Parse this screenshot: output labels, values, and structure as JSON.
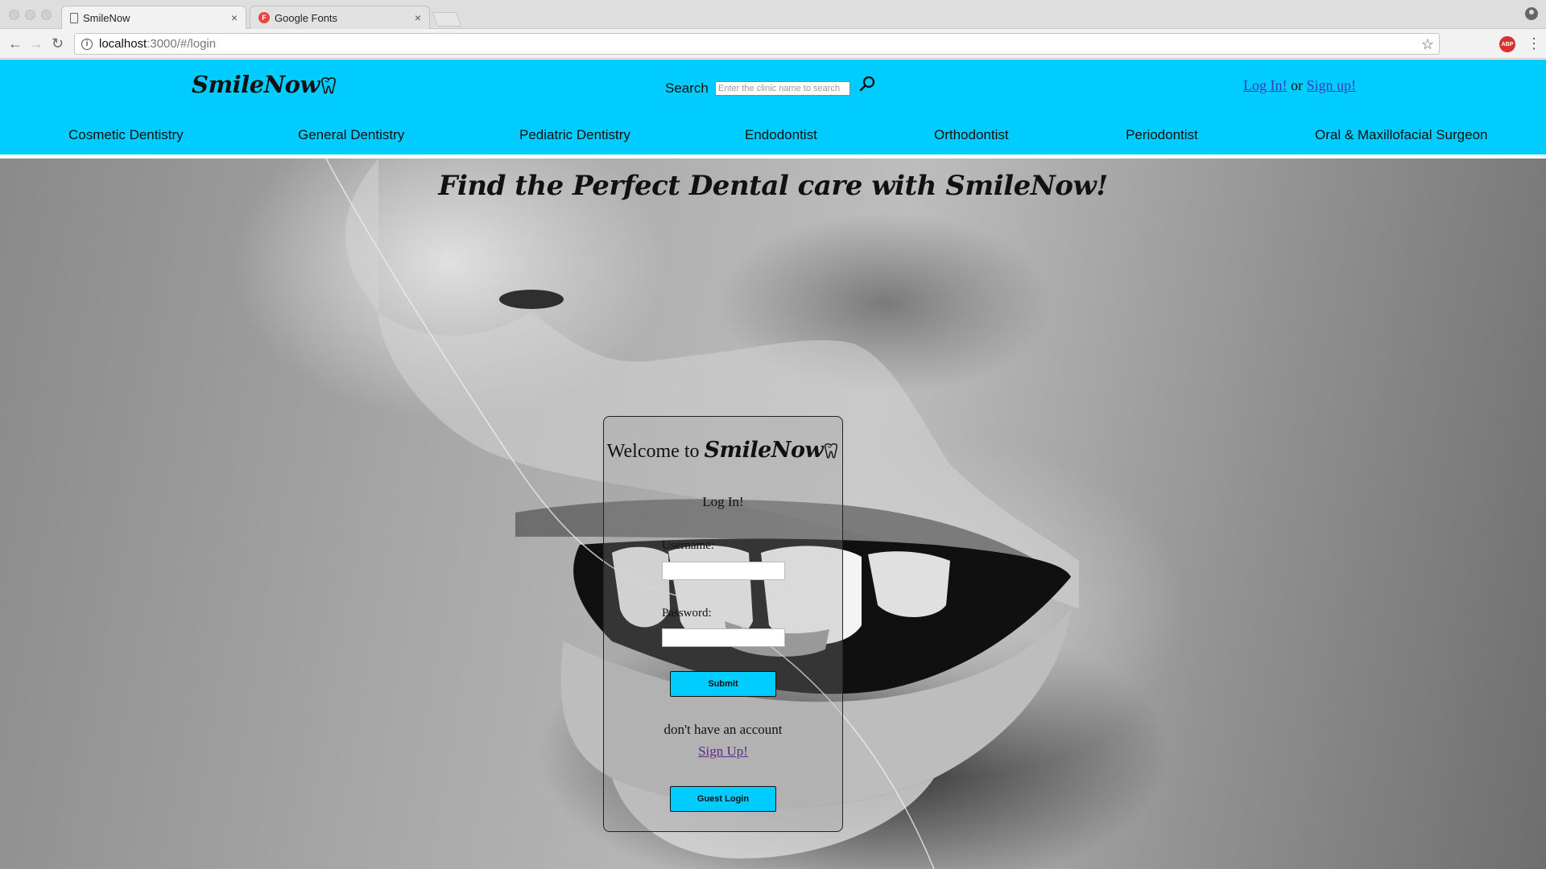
{
  "browser": {
    "tabs": [
      {
        "title": "SmileNow",
        "close": "×"
      },
      {
        "title": "Google Fonts",
        "close": "×",
        "favicon": "F"
      }
    ],
    "url_host": "localhost",
    "url_rest": ":3000/#/login",
    "abp_label": "ABP"
  },
  "header": {
    "logo": "SmileNow",
    "search_label": "Search",
    "search_placeholder": "Enter the clinic name to search",
    "auth": {
      "login": "Log In!",
      "or": "or",
      "signup": "Sign up!"
    },
    "categories": [
      "Cosmetic Dentistry",
      "General Dentistry",
      "Pediatric Dentistry",
      "Endodontist",
      "Orthodontist",
      "Periodontist",
      "Oral & Maxillofacial Surgeon"
    ]
  },
  "hero": {
    "title": "Find the Perfect Dental care with SmileNow!"
  },
  "login_card": {
    "welcome": "Welcome to",
    "brand": "SmileNow",
    "heading": "Log In!",
    "username_label": "Username:",
    "password_label": "Password:",
    "submit_label": "Submit",
    "no_account_text": "don't have an account",
    "signup_link": "Sign Up!",
    "guest_label": "Guest Login"
  },
  "colors": {
    "header_bg": "#00ccff",
    "button_bg": "#00ccff",
    "link_blue": "#3b3bc2",
    "visited_link": "#5b2a86"
  }
}
